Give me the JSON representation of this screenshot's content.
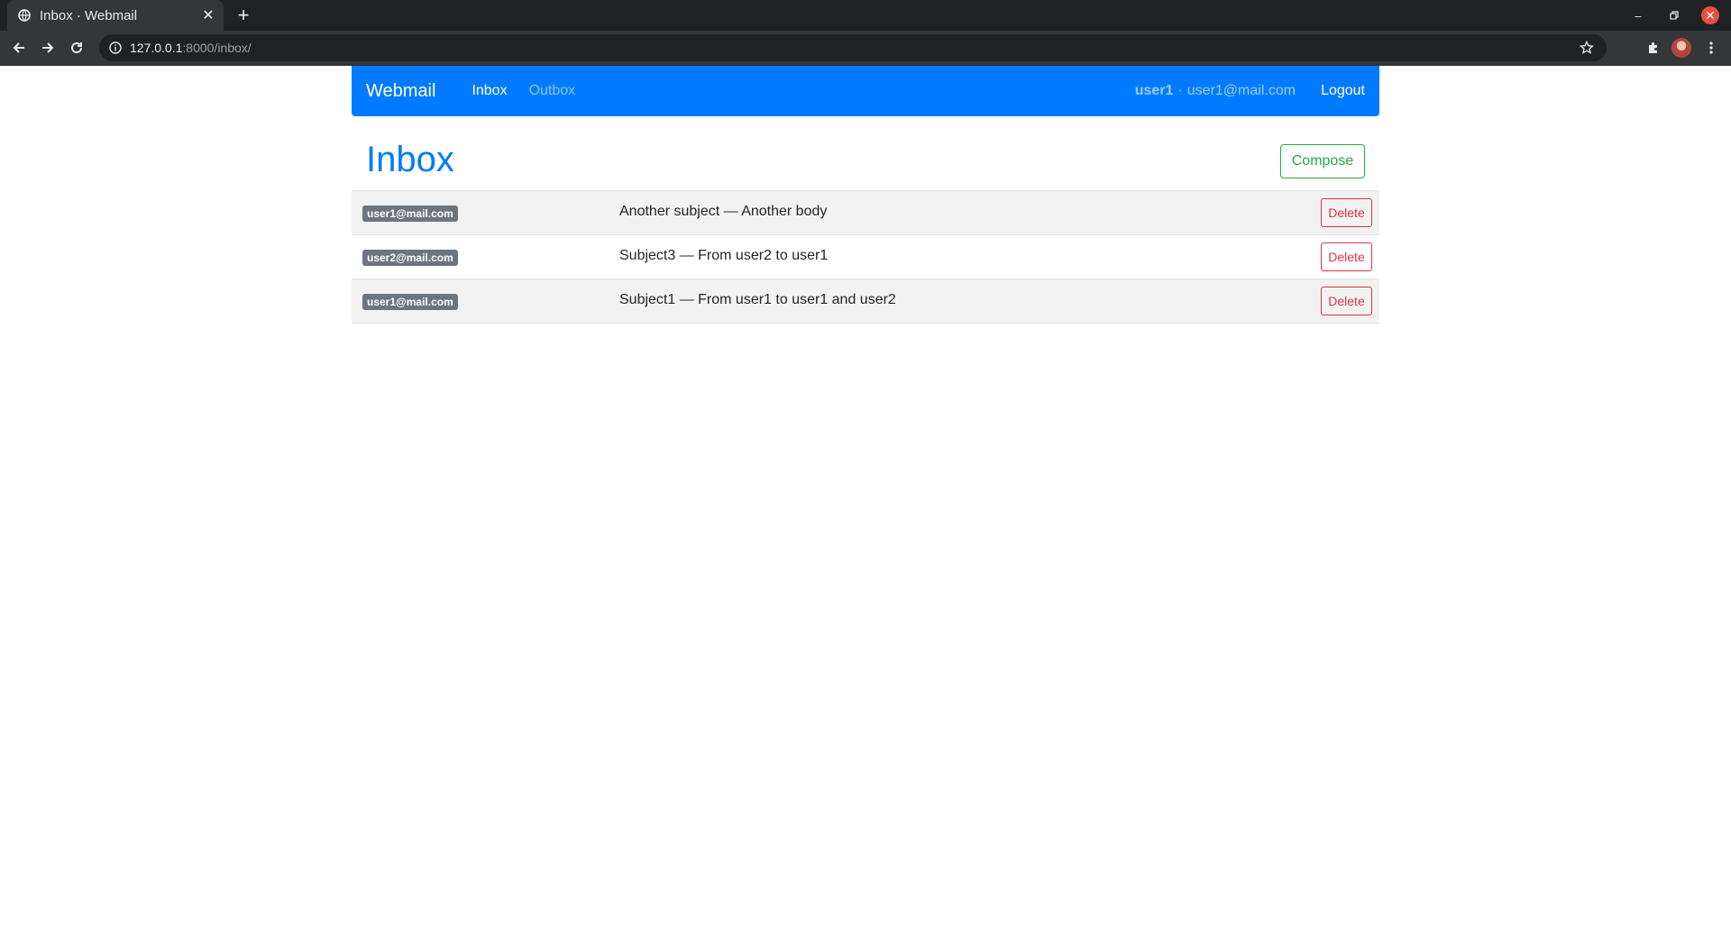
{
  "browser": {
    "tab_title": "Inbox · Webmail",
    "url_host": "127.0.0.1",
    "url_path": ":8000/inbox/"
  },
  "navbar": {
    "brand": "Webmail",
    "links": [
      {
        "label": "Inbox"
      },
      {
        "label": "Outbox"
      }
    ],
    "user_name": "user1",
    "user_separator": "·",
    "user_email": "user1@mail.com",
    "logout_label": "Logout"
  },
  "main": {
    "title": "Inbox",
    "compose_label": "Compose",
    "messages": [
      {
        "sender": "user1@mail.com",
        "summary": "Another subject — Another body",
        "delete_label": "Delete"
      },
      {
        "sender": "user2@mail.com",
        "summary": "Subject3 — From user2 to user1",
        "delete_label": "Delete"
      },
      {
        "sender": "user1@mail.com",
        "summary": "Subject1 — From user1 to user1 and user2",
        "delete_label": "Delete"
      }
    ]
  },
  "colors": {
    "primary": "#007bff",
    "success": "#28a745",
    "danger": "#dc3545",
    "badge": "#6c757d"
  }
}
